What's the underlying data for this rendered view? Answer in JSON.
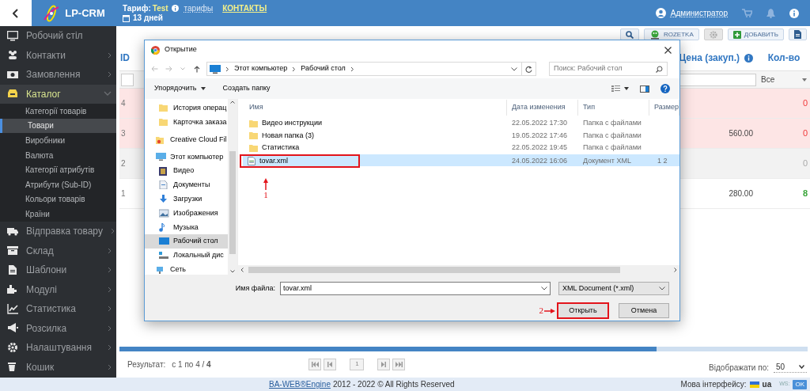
{
  "header": {
    "logo": "LP-CRM",
    "tariff_label": "Тариф:",
    "tariff_name": "Test",
    "tariffs_link": "тарифы",
    "contacts_link": "КОНТАКТЫ",
    "days_left": "13 дней",
    "user": "Администратор"
  },
  "sidebar": {
    "items": [
      {
        "label": "Робочий стіл",
        "selected": false
      },
      {
        "label": "Контакти",
        "selected": false,
        "expanded": false
      },
      {
        "label": "Замовлення",
        "selected": false,
        "expanded": false
      },
      {
        "label": "Каталог",
        "selected": true,
        "expanded": true,
        "children": [
          {
            "label": "Категорії товарів",
            "selected": false
          },
          {
            "label": "Товари",
            "selected": true
          },
          {
            "label": "Виробники",
            "selected": false
          },
          {
            "label": "Валюта",
            "selected": false
          },
          {
            "label": "Категорії атрибутів",
            "selected": false
          },
          {
            "label": "Атрибути (Sub-ID)",
            "selected": false
          },
          {
            "label": "Кольори товарів",
            "selected": false
          },
          {
            "label": "Країни",
            "selected": false
          }
        ]
      },
      {
        "label": "Відправка товару",
        "selected": false,
        "expanded": false
      },
      {
        "label": "Склад",
        "selected": false,
        "expanded": false
      },
      {
        "label": "Шаблони",
        "selected": false,
        "expanded": false
      },
      {
        "label": "Модулі",
        "selected": false,
        "expanded": false
      },
      {
        "label": "Статистика",
        "selected": false,
        "expanded": false
      },
      {
        "label": "Розсилка",
        "selected": false,
        "expanded": false
      },
      {
        "label": "Налаштування",
        "selected": false,
        "expanded": false
      },
      {
        "label": "Кошик",
        "selected": false,
        "expanded": false
      }
    ]
  },
  "toolbar": [
    {
      "kind": "search"
    },
    {
      "kind": "rozetka",
      "label": "ROZETKA"
    },
    {
      "kind": "settings"
    },
    {
      "kind": "add",
      "label": "ДОБАВИТЬ"
    },
    {
      "kind": "export"
    }
  ],
  "table": {
    "columns": [
      {
        "label": "ID"
      },
      {
        "label": "Цена (закуп.)"
      },
      {
        "label": "Кол-во"
      }
    ],
    "qty_filter": "Все",
    "rows": [
      {
        "id": "4",
        "qty": "0",
        "kind": "out_of_stock"
      },
      {
        "id": "3",
        "price": "560.00",
        "qty": "0",
        "kind": "out_of_stock"
      },
      {
        "id": "2",
        "qty": "0",
        "kind": "inactive"
      },
      {
        "id": "1",
        "price": "280.00",
        "qty": "8",
        "kind": "in_stock"
      }
    ]
  },
  "pagination": {
    "result_label": "Результат:",
    "result_range": "с 1 по 4 / **4**",
    "page": "1",
    "per_page_label": "Відображати по:",
    "per_page": "50"
  },
  "footer": {
    "engine_link": "BA-WEB®Engine",
    "copyright": "2012 - 2022 © All Rights Reserved",
    "language_label": "Мова інтерфейсу:",
    "language": "ua",
    "ws_label": "WS:",
    "ws_status": "OK"
  },
  "dialog": {
    "title": "Открытие",
    "path": [
      "Этот компьютер",
      "Рабочий стол"
    ],
    "search_placeholder": "Поиск: Рабочий стол",
    "organize": "Упорядочить",
    "new_folder": "Создать папку",
    "nav": [
      {
        "label": "История операц",
        "kind": "folder",
        "selected": false
      },
      {
        "label": "Карточка заказа",
        "kind": "folder",
        "selected": false
      },
      {
        "label": "Creative Cloud Fil",
        "kind": "cloud",
        "selected": false
      },
      {
        "label": "Этот компьютер",
        "kind": "pc",
        "selected": false,
        "children": [
          {
            "label": "Видео",
            "kind": "video",
            "selected": false
          },
          {
            "label": "Документы",
            "kind": "docs",
            "selected": false
          },
          {
            "label": "Загрузки",
            "kind": "downloads",
            "selected": false
          },
          {
            "label": "Изображения",
            "kind": "images",
            "selected": false
          },
          {
            "label": "Музыка",
            "kind": "music",
            "selected": false
          },
          {
            "label": "Рабочий стол",
            "kind": "desktop",
            "selected": true
          },
          {
            "label": "Локальный дис",
            "kind": "disk",
            "selected": false
          }
        ]
      },
      {
        "label": "Сеть",
        "kind": "network",
        "selected": false
      }
    ],
    "columns": [
      "Имя",
      "Дата изменения",
      "Тип",
      "Размер"
    ],
    "files": [
      {
        "name": "Видео инструкции",
        "date": "22.05.2022 17:30",
        "type": "Папка с файлами",
        "kind": "folder",
        "selected": false
      },
      {
        "name": "Новая папка (3)",
        "date": "19.05.2022 17:46",
        "type": "Папка с файлами",
        "kind": "folder",
        "selected": false
      },
      {
        "name": "Статистика",
        "date": "22.05.2022 19:45",
        "type": "Папка с файлами",
        "kind": "folder",
        "selected": false
      },
      {
        "name": "tovar.xml",
        "date": "24.05.2022 16:06",
        "type": "Документ XML",
        "size": "1 2",
        "kind": "xml",
        "selected": true,
        "callout": "1"
      }
    ],
    "filename_label": "Имя файла:",
    "filename": "tovar.xml",
    "filter": "XML Document (*.xml)",
    "buttons": [
      {
        "label": "Открыть",
        "callout": "2"
      },
      {
        "label": "Отмена"
      }
    ]
  }
}
